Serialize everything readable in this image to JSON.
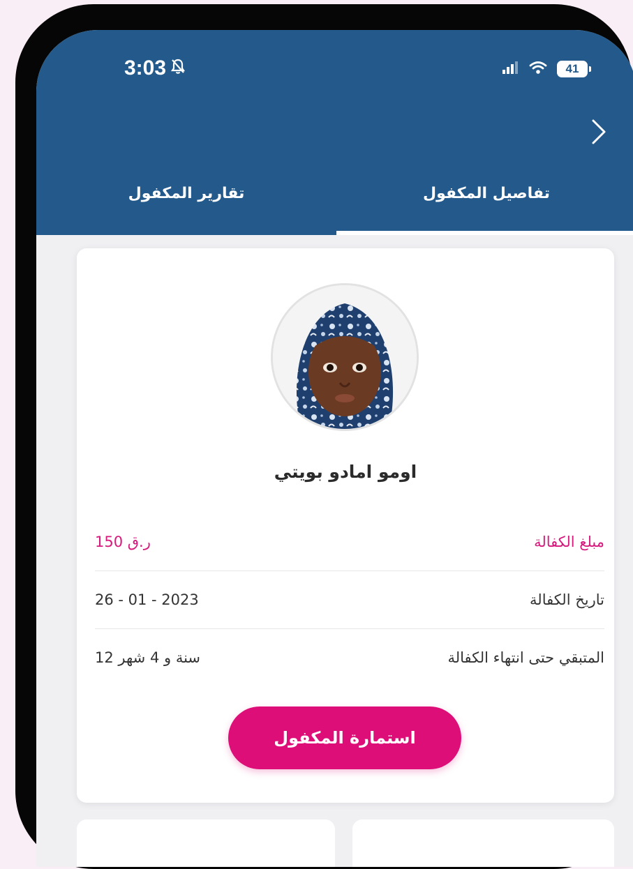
{
  "status_bar": {
    "time": "3:03",
    "battery": "41"
  },
  "tabs": [
    {
      "label": "تفاصيل المكفول",
      "active": true
    },
    {
      "label": "تقارير المكفول",
      "active": false
    }
  ],
  "profile": {
    "name": "اومو امادو بويتي"
  },
  "details": [
    {
      "label": "مبلغ الكفالة",
      "value": "150 ر.ق"
    },
    {
      "label": "تاريخ الكفالة",
      "value": "26 - 01 - 2023"
    },
    {
      "label": "المتبقي حتى انتهاء الكفالة",
      "value": "12 سنة و 4 شهر"
    }
  ],
  "cta": {
    "label": "استمارة المكفول"
  },
  "colors": {
    "header_blue": "#235a8b",
    "accent_pink": "#de0e78",
    "page_bg": "#f9eef5"
  },
  "icons": {
    "bell": "bell-slash-icon",
    "signal": "signal-icon",
    "wifi": "wifi-icon",
    "back": "chevron-right-icon"
  }
}
